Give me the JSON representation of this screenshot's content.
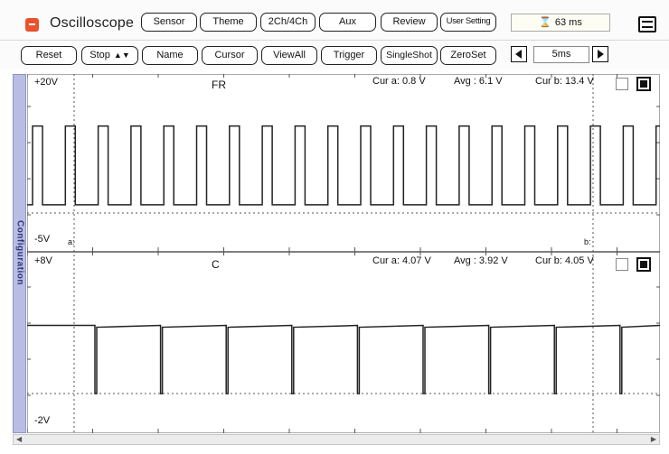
{
  "app": {
    "title": "Oscilloscope"
  },
  "toolbar1": {
    "sensor": "Sensor",
    "theme": "Theme",
    "channels": "2Ch/4Ch",
    "aux": "Aux",
    "review": "Review",
    "user_setting": "User Setting",
    "time_display": "63 ms"
  },
  "toolbar2": {
    "reset": "Reset",
    "stop": "Stop",
    "name": "Name",
    "cursor": "Cursor",
    "view_all": "ViewAll",
    "trigger": "Trigger",
    "single_shot": "SingleShot",
    "zero_set": "ZeroSet",
    "timebase": "5ms"
  },
  "sidebar": {
    "configuration": "Configuration"
  },
  "channels": [
    {
      "name": "FR",
      "top_label": "+20V",
      "bottom_label": "-5V",
      "ymax": 20,
      "ymin": -5,
      "cur_a": "Cur a: 0.8 V",
      "avg": "Avg : 6.1 V",
      "cur_b": "Cur b: 13.4 V",
      "cursor_a_label": "a:",
      "cursor_b_label": "b:"
    },
    {
      "name": "C",
      "top_label": "+8V",
      "bottom_label": "-2V",
      "ymax": 8,
      "ymin": -2,
      "cur_a": "Cur a: 4.07 V",
      "avg": "Avg : 3.92 V",
      "cur_b": "Cur b: 4.05 V"
    }
  ],
  "colors": {
    "trace": "#222222",
    "grid": "#555555",
    "config_tab": "#b9bde3"
  }
}
